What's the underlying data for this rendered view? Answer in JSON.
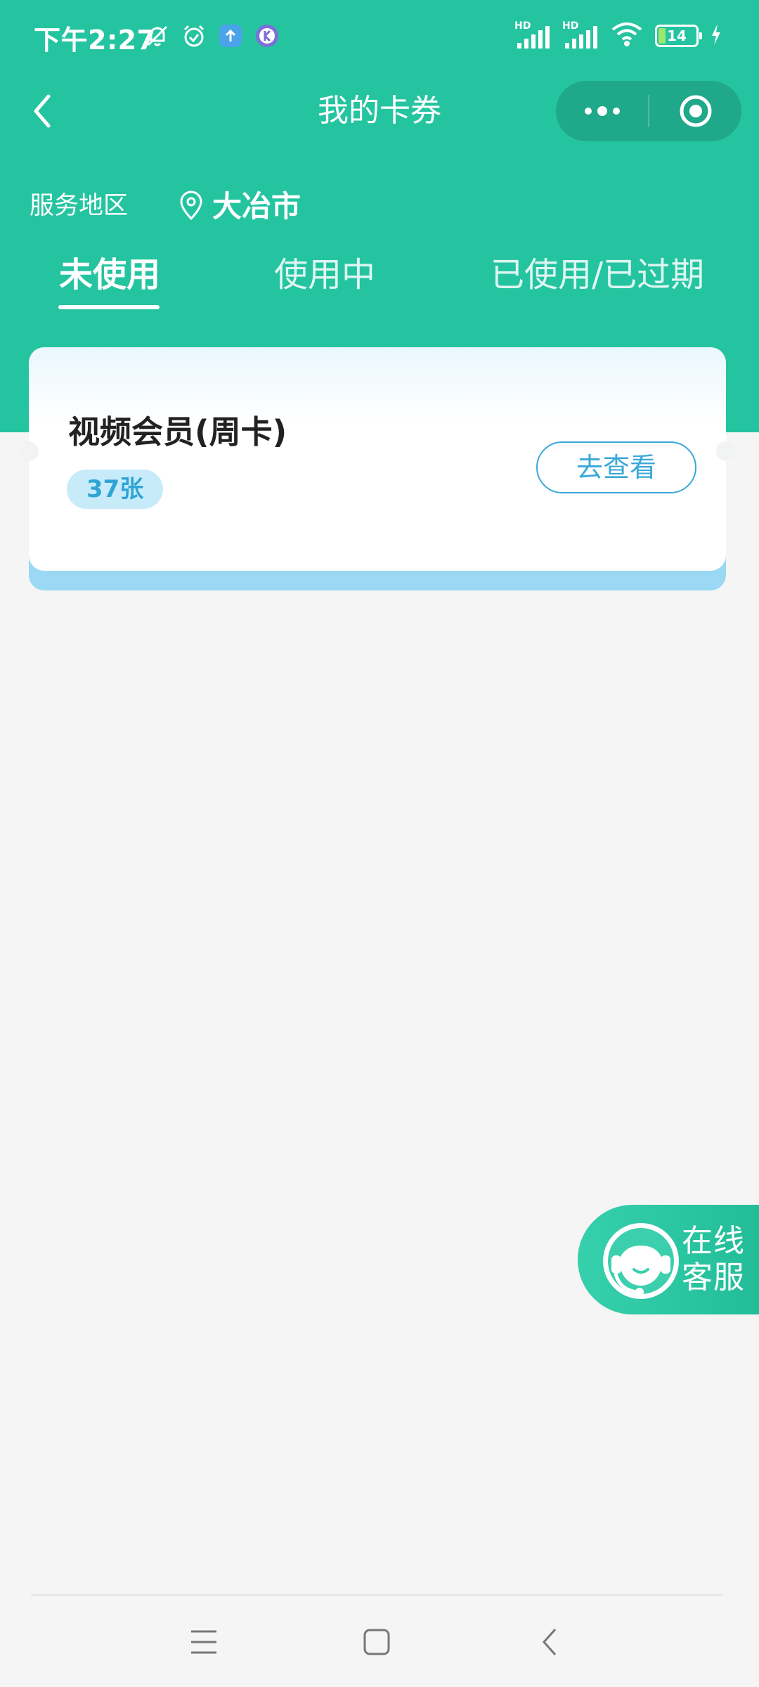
{
  "status_bar": {
    "time": "下午2:27",
    "signal_1_label": "HD",
    "signal_2_label": "HD",
    "battery_level": "14",
    "icons": [
      "mute-icon",
      "alarm-icon",
      "upload-app-icon",
      "kuaishou-app-icon",
      "signal-icon",
      "signal-icon",
      "wifi-icon",
      "battery-icon",
      "charging-icon"
    ]
  },
  "header": {
    "title": "我的卡券",
    "back_icon": "chevron-left-icon",
    "capsule_icons": [
      "more-icon",
      "close-target-icon"
    ]
  },
  "region": {
    "label": "服务地区",
    "city": "大冶市",
    "icon": "location-pin-icon"
  },
  "tabs": [
    {
      "label": "未使用",
      "active": true
    },
    {
      "label": "使用中",
      "active": false
    },
    {
      "label": "已使用/已过期",
      "active": false
    }
  ],
  "coupons": [
    {
      "title": "视频会员(周卡)",
      "count": "37张",
      "action": "去查看"
    }
  ],
  "online_service": {
    "line1": "在线",
    "line2": "客服",
    "icon": "customer-service-icon"
  },
  "nav": {
    "icons": [
      "menu-icon",
      "home-icon",
      "back-icon"
    ]
  },
  "colors": {
    "brand": "#25c4a0",
    "accent_blue": "#3aa9d8",
    "background": "#f5f5f5"
  }
}
